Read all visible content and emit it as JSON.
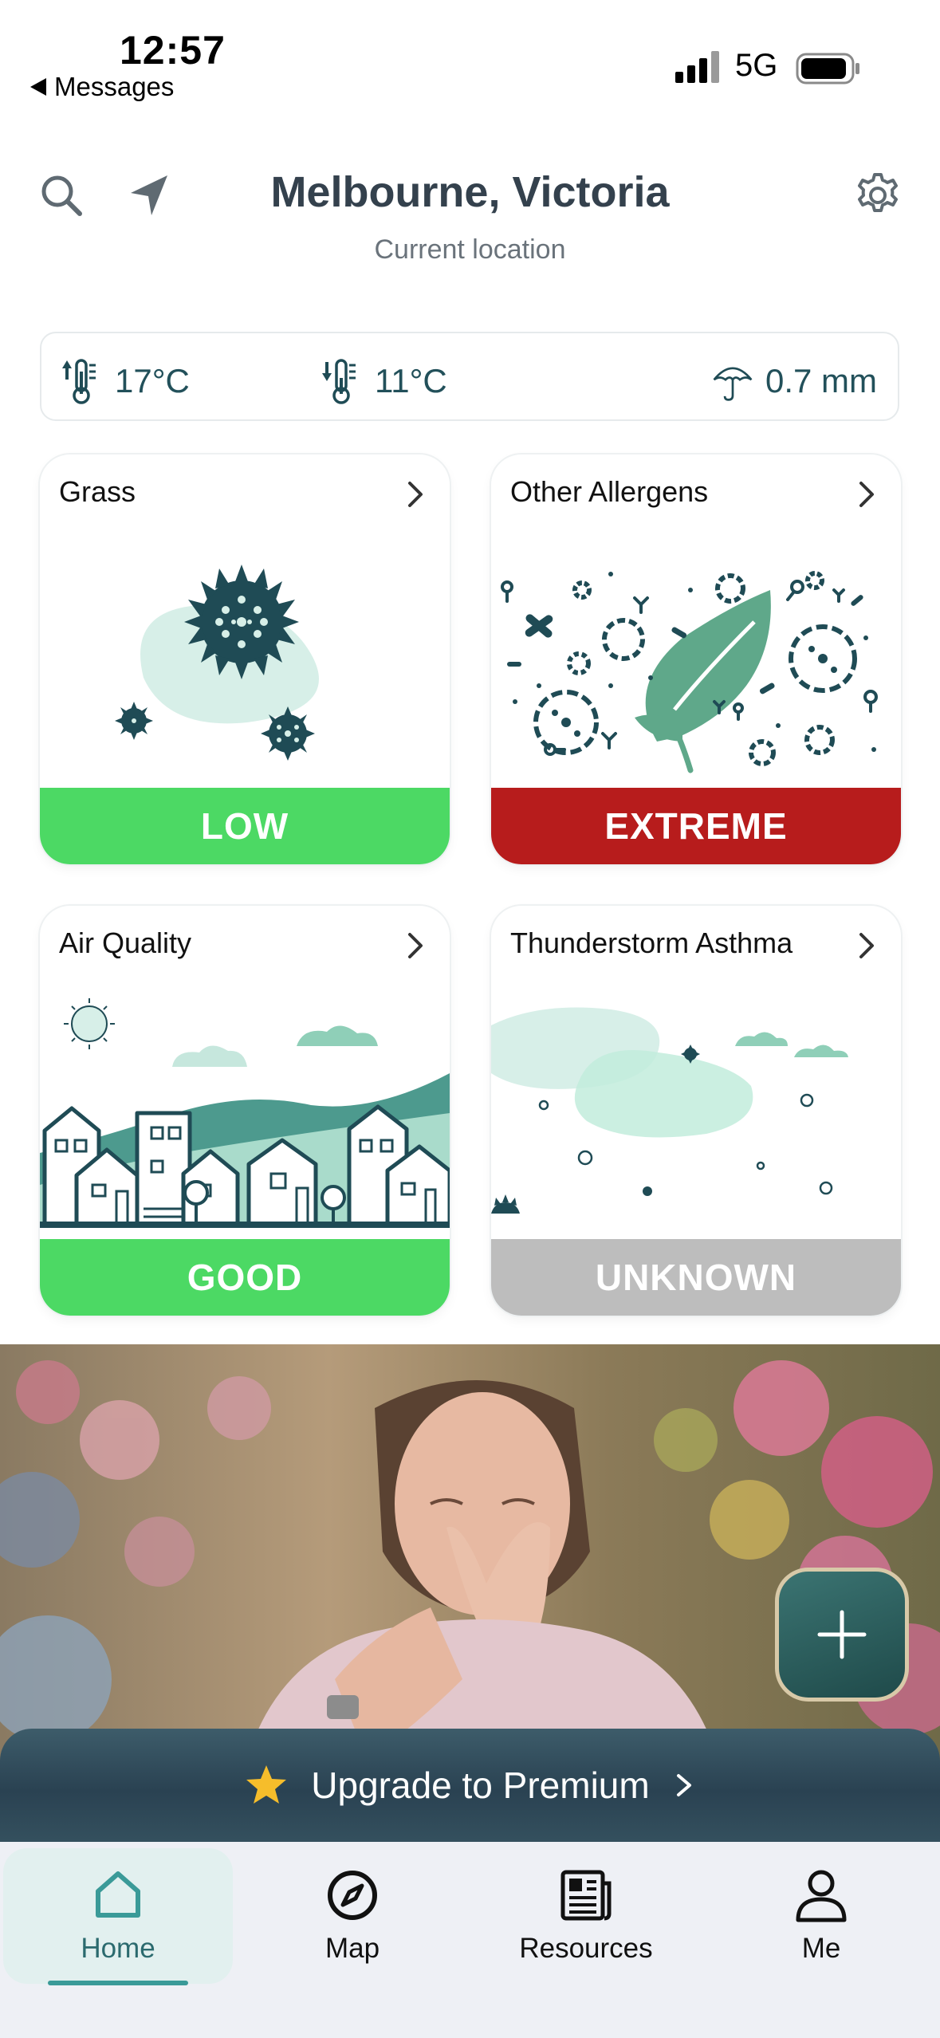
{
  "status_bar": {
    "time": "12:57",
    "back_app": "Messages",
    "network": "5G"
  },
  "header": {
    "title": "Melbourne, Victoria",
    "subtitle": "Current location"
  },
  "weather": {
    "max_temp": "17°C",
    "min_temp": "11°C",
    "rain": "0.7 mm"
  },
  "cards": [
    {
      "title": "Grass",
      "level": "LOW",
      "color": "#4cd964"
    },
    {
      "title": "Other Allergens",
      "level": "EXTREME",
      "color": "#b71c1c"
    },
    {
      "title": "Air Quality",
      "level": "GOOD",
      "color": "#4cd964"
    },
    {
      "title": "Thunderstorm Asthma",
      "level": "UNKNOWN",
      "color": "#bdbdbd"
    }
  ],
  "premium": {
    "label": "Upgrade to Premium"
  },
  "tabs": [
    {
      "label": "Home",
      "icon": "home-icon",
      "active": true
    },
    {
      "label": "Map",
      "icon": "compass-icon"
    },
    {
      "label": "Resources",
      "icon": "newspaper-icon"
    },
    {
      "label": "Me",
      "icon": "person-icon"
    }
  ],
  "colors": {
    "accent": "#2b6a6e",
    "dark_teal": "#1f4b55",
    "band_green": "#4cd964",
    "band_red": "#b71c1c",
    "band_grey": "#bdbdbd"
  }
}
